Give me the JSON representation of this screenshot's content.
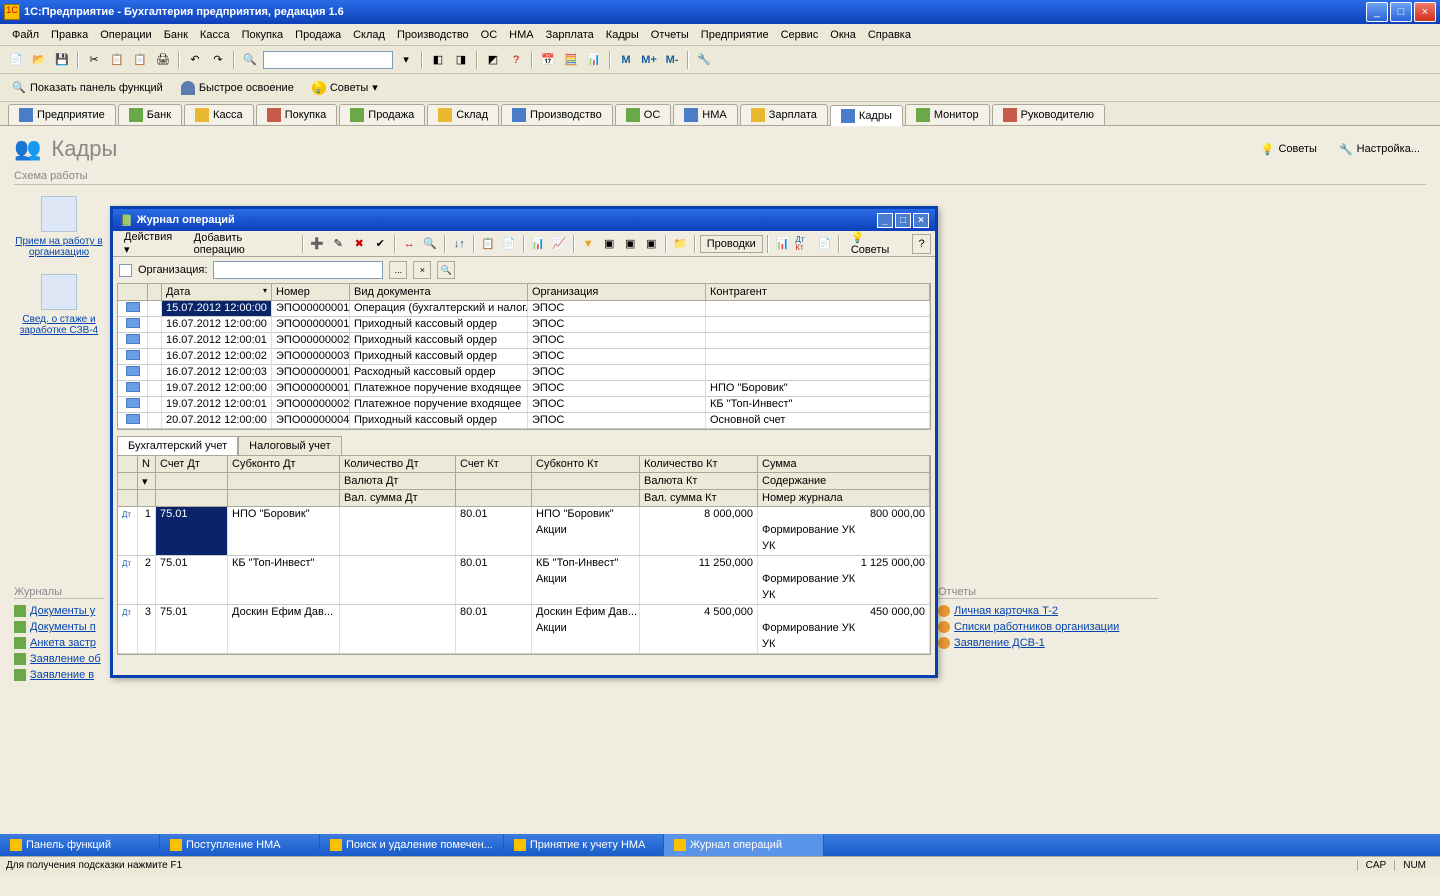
{
  "title": "1С:Предприятие  - Бухгалтерия предприятия, редакция 1.6",
  "menu": [
    "Файл",
    "Правка",
    "Операции",
    "Банк",
    "Касса",
    "Покупка",
    "Продажа",
    "Склад",
    "Производство",
    "ОС",
    "НМА",
    "Зарплата",
    "Кадры",
    "Отчеты",
    "Предприятие",
    "Сервис",
    "Окна",
    "Справка"
  ],
  "toolbar2": {
    "panel": "Показать панель функций",
    "quick": "Быстрое освоение",
    "advice": "Советы"
  },
  "navtabs": [
    "Предприятие",
    "Банк",
    "Касса",
    "Покупка",
    "Продажа",
    "Склад",
    "Производство",
    "ОС",
    "НМА",
    "Зарплата",
    "Кадры",
    "Монитор",
    "Руководителю"
  ],
  "navtab_active": 10,
  "page": {
    "title": "Кадры",
    "actions": {
      "advice": "Советы",
      "settings": "Настройка..."
    },
    "scheme": "Схема работы"
  },
  "sidebar": {
    "items": [
      {
        "label": "Прием на работу в организацию"
      },
      {
        "label": "Свед. о стаже и заработке СЗВ-4"
      }
    ]
  },
  "journals": {
    "title": "Журналы",
    "items": [
      "Документы у",
      "Документы п",
      "Анкета застр",
      "Заявление об",
      "Заявление в "
    ]
  },
  "reports": {
    "title": "Отчеты",
    "items": [
      "Личная карточка T-2",
      "Списки работников организации",
      "Заявление ДСВ-1"
    ]
  },
  "dialog": {
    "title": "Журнал операций",
    "toolbar": {
      "actions": "Действия",
      "add": "Добавить операцию",
      "provodki": "Проводки",
      "advice": "Советы"
    },
    "filter": {
      "org_label": "Организация:"
    },
    "grid": {
      "headers": [
        "Дата",
        "Номер",
        "Вид документа",
        "Организация",
        "Контрагент"
      ],
      "rows": [
        {
          "date": "15.07.2012 12:00:00",
          "num": "ЭПО00000001",
          "type": "Операция (бухгалтерский и налог...",
          "org": "ЭПОС",
          "contr": ""
        },
        {
          "date": "16.07.2012 12:00:00",
          "num": "ЭПО00000001",
          "type": "Приходный кассовый ордер",
          "org": "ЭПОС",
          "contr": ""
        },
        {
          "date": "16.07.2012 12:00:01",
          "num": "ЭПО00000002",
          "type": "Приходный кассовый ордер",
          "org": "ЭПОС",
          "contr": ""
        },
        {
          "date": "16.07.2012 12:00:02",
          "num": "ЭПО00000003",
          "type": "Приходный кассовый ордер",
          "org": "ЭПОС",
          "contr": ""
        },
        {
          "date": "16.07.2012 12:00:03",
          "num": "ЭПО00000001",
          "type": "Расходный кассовый ордер",
          "org": "ЭПОС",
          "contr": ""
        },
        {
          "date": "19.07.2012 12:00:00",
          "num": "ЭПО00000001",
          "type": "Платежное поручение входящее",
          "org": "ЭПОС",
          "contr": "НПО \"Боровик\""
        },
        {
          "date": "19.07.2012 12:00:01",
          "num": "ЭПО00000002",
          "type": "Платежное поручение входящее",
          "org": "ЭПОС",
          "contr": "КБ \"Топ-Инвест\""
        },
        {
          "date": "20.07.2012 12:00:00",
          "num": "ЭПО00000004",
          "type": "Приходный кассовый ордер",
          "org": "ЭПОС",
          "contr": "Основной счет"
        }
      ],
      "selected": 0
    },
    "subtabs": [
      "Бухгалтерский учет",
      "Налоговый учет"
    ],
    "detail": {
      "headers": {
        "n": "N",
        "dt": "Счет Дт",
        "subdt": "Субконто Дт",
        "qtydt": "Количество Дт",
        "valdt": "Валюта Дт",
        "sumdt": "Вал. сумма Дт",
        "kt": "Счет Кт",
        "subkt": "Субконто Кт",
        "qtykt": "Количество Кт",
        "valkt": "Валюта Кт",
        "sumkt": "Вал. сумма Кт",
        "sum": "Сумма",
        "desc": "Содержание",
        "jnum": "Номер журнала"
      },
      "rows": [
        {
          "n": "1",
          "dt": "75.01",
          "subdt": "НПО \"Боровик\"",
          "kt": "80.01",
          "subkt1": "НПО \"Боровик\"",
          "subkt2": "Акции",
          "qtykt": "8 000,000",
          "sum": "800 000,00",
          "desc": "Формирование УК",
          "jnum": "УК"
        },
        {
          "n": "2",
          "dt": "75.01",
          "subdt": "КБ \"Топ-Инвест\"",
          "kt": "80.01",
          "subkt1": "КБ \"Топ-Инвест\"",
          "subkt2": "Акции",
          "qtykt": "11 250,000",
          "sum": "1 125 000,00",
          "desc": "Формирование УК",
          "jnum": "УК"
        },
        {
          "n": "3",
          "dt": "75.01",
          "subdt": "Доскин Ефим Дав...",
          "kt": "80.01",
          "subkt1": "Доскин Ефим Дав...",
          "subkt2": "Акции",
          "qtykt": "4 500,000",
          "sum": "450 000,00",
          "desc": "Формирование УК",
          "jnum": "УК"
        }
      ]
    }
  },
  "taskbar": [
    "Панель функций",
    "Поступление НМА",
    "Поиск и удаление помечен...",
    "Принятие к учету НМА",
    "Журнал операций"
  ],
  "taskbar_active": 4,
  "statusbar": {
    "hint": "Для получения подсказки нажмите F1",
    "cap": "CAP",
    "num": "NUM"
  },
  "mmbuttons": {
    "m": "M",
    "mplus": "M+",
    "mminus": "M-"
  }
}
